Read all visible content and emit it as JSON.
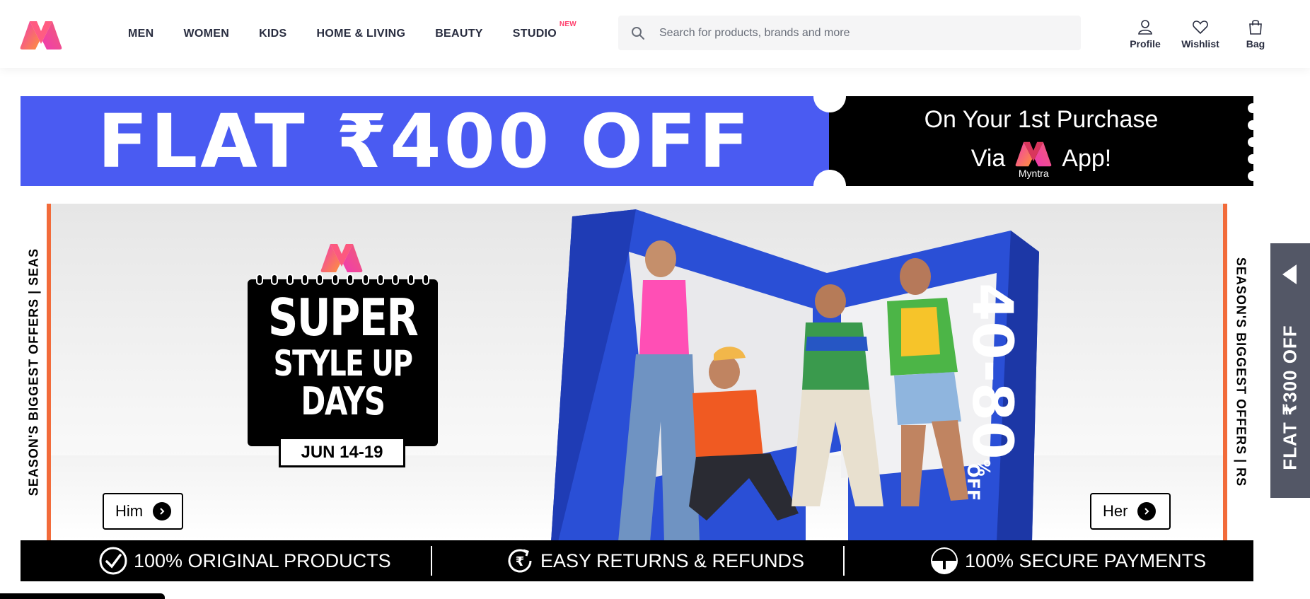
{
  "header": {
    "nav": [
      {
        "label": "MEN"
      },
      {
        "label": "WOMEN"
      },
      {
        "label": "KIDS"
      },
      {
        "label": "HOME & LIVING"
      },
      {
        "label": "BEAUTY"
      },
      {
        "label": "STUDIO",
        "badge": "NEW"
      }
    ],
    "search_placeholder": "Search for products, brands and more",
    "actions": [
      {
        "label": "Profile",
        "icon": "profile-icon"
      },
      {
        "label": "Wishlist",
        "icon": "heart-icon"
      },
      {
        "label": "Bag",
        "icon": "bag-icon"
      }
    ]
  },
  "promo": {
    "headline": "FLAT ₹400 OFF",
    "line1": "On Your 1st Purchase",
    "line2_prefix": "Via",
    "line2_suffix": "App!",
    "brand": "Myntra"
  },
  "hero": {
    "strip_left": "SEASON'S BIGGEST OFFERS   |   SEAS",
    "strip_right": "SEASON'S BIGGEST OFFERS   |   RS",
    "title1": "SUPER",
    "title2": "STYLE UP",
    "title3": "DAYS",
    "date": "JUN 14-19",
    "discount": "40-80",
    "discount_suffix": "%",
    "discount_off": "OFF",
    "cta_him": "Him",
    "cta_her": "Her"
  },
  "trust": [
    {
      "label": "100% ORIGINAL PRODUCTS",
      "icon": "check-circle-icon"
    },
    {
      "label": "EASY RETURNS & REFUNDS",
      "icon": "rupee-refresh-icon"
    },
    {
      "label": "100% SECURE PAYMENTS",
      "icon": "umbrella-shield-icon"
    }
  ],
  "floating_tab": {
    "label": "FLAT ₹300 OFF"
  },
  "colors": {
    "brand_pink": "#ff3f6c",
    "promo_blue": "#4a5bf2",
    "accent_orange": "#f26b3a",
    "tab_gray": "#535766"
  }
}
